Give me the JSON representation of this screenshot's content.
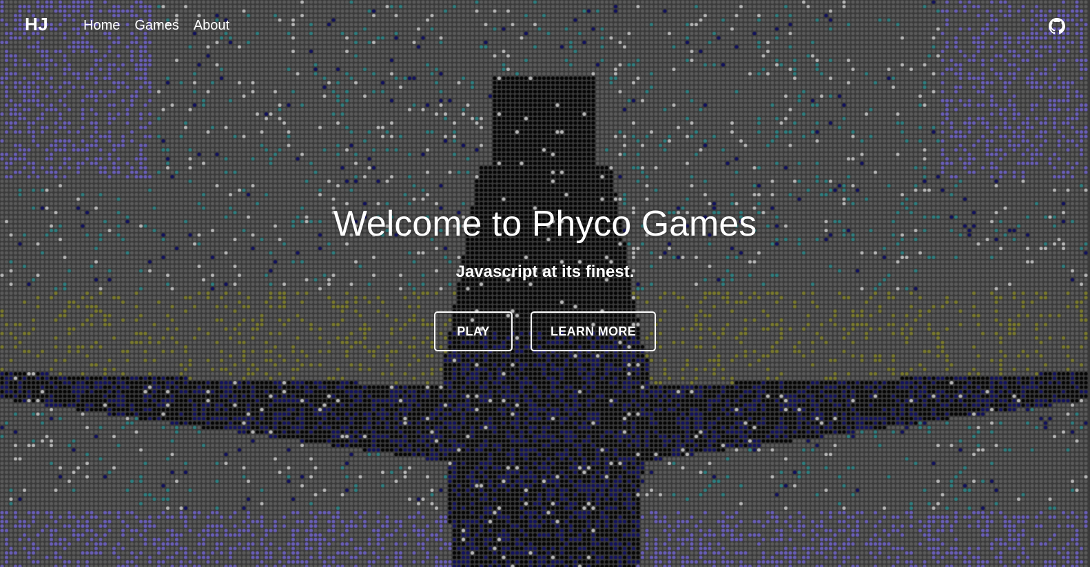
{
  "navbar": {
    "brand": "HJ",
    "links": [
      {
        "label": "Home"
      },
      {
        "label": "Games"
      },
      {
        "label": "About"
      }
    ],
    "github_icon": "github-icon"
  },
  "hero": {
    "title": "Welcome to Phyco Games",
    "subtitle": "Javascript at its finest.",
    "buttons": {
      "play_label": "PLAY",
      "learn_more_label": "LEARN MORE"
    }
  },
  "background": {
    "style": "dot-matrix pixel art of a standing figure on a grey dotted field",
    "colors": {
      "base_dot": "#5a5a5a",
      "gap": "#3a3a3a",
      "figure": "#050505",
      "accent_purple": "#6a5fb8",
      "accent_teal": "#2f7f80",
      "accent_olive": "#7a7a2e",
      "accent_navy": "#12125e",
      "accent_light": "#b8b8b8"
    }
  }
}
